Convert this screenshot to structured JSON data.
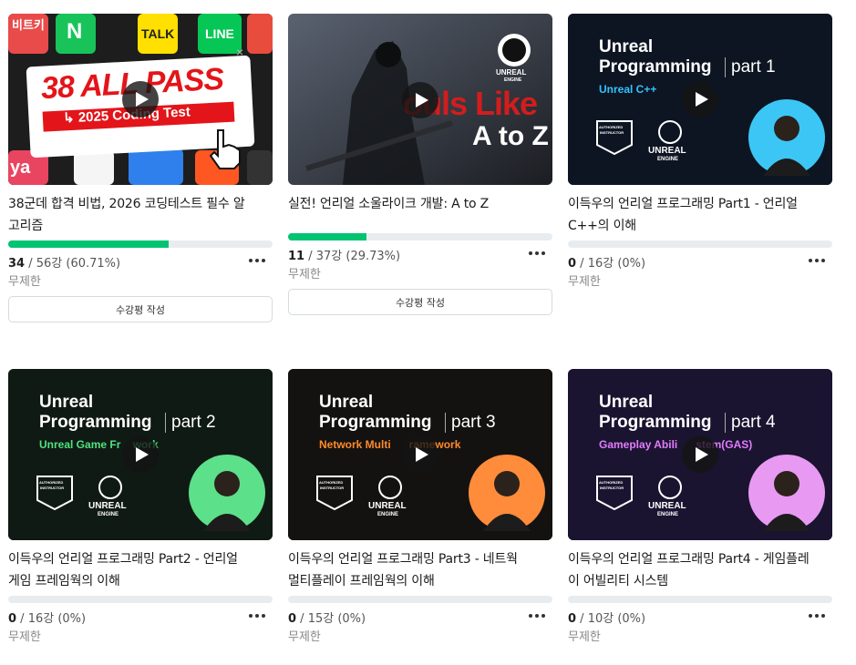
{
  "courses": [
    {
      "title_line1": "38군데 합격 비법, 2026 코딩테스트 필수 알",
      "title_line2": "고리즘",
      "progress_done": "34",
      "progress_rest": " / 56강 (60.71%)",
      "progress_fraction": 0.6071,
      "period": "무제한",
      "review_label": "수강평 작성",
      "thumb": {
        "badge_text": "38 ALL PASS",
        "sub_text": "↳ 2025 Coding Test",
        "app_labels": [
          "비트키",
          "N",
          "TALK",
          "LINE",
          "ya"
        ],
        "close_glyph": "×"
      }
    },
    {
      "title_line1": "실전! 언리얼 소울라이크 개발: A to Z",
      "title_line2": "",
      "progress_done": "11",
      "progress_rest": " / 37강 (29.73%)",
      "progress_fraction": 0.2973,
      "period": "무제한",
      "review_label": "수강평 작성",
      "thumb": {
        "big_text": "ouls Like",
        "sub_text": "A to Z",
        "logo_word": "UNREAL",
        "logo_sub": "ENGINE"
      }
    },
    {
      "title_line1": "이득우의 언리얼 프로그래밍 Part1 - 언리얼",
      "title_line2": "C++의 이해",
      "progress_done": "0",
      "progress_rest": " / 16강 (0%)",
      "progress_fraction": 0,
      "period": "무제한",
      "thumb": {
        "line1": "Unreal",
        "line2": "Programming",
        "part": "part 1",
        "subtitle": "Unreal C++",
        "accent": "#33c3ff",
        "bg": "#0d1522",
        "circle": "#3cc6f5"
      }
    },
    {
      "title_line1": "이득우의 언리얼 프로그래밍 Part2 - 언리얼",
      "title_line2": "게임 프레임웍의 이해",
      "progress_done": "0",
      "progress_rest": " / 16강 (0%)",
      "progress_fraction": 0,
      "period": "무제한",
      "thumb": {
        "line1": "Unreal",
        "line2": "Programming",
        "part": "part 2",
        "subtitle": "Unreal Game Fr    work",
        "accent": "#4ee37e",
        "bg": "#101a14",
        "circle": "#5de08a"
      }
    },
    {
      "title_line1": "이득우의 언리얼 프로그래밍 Part3 - 네트웍",
      "title_line2": "멀티플레이 프레임웍의 이해",
      "progress_done": "0",
      "progress_rest": " / 15강 (0%)",
      "progress_fraction": 0,
      "period": "무제한",
      "thumb": {
        "line1": "Unreal",
        "line2": "Programming",
        "part": "part 3",
        "subtitle": "Network Multi      ramework",
        "accent": "#ff8a2b",
        "bg": "#141210",
        "circle": "#ff8c3a"
      }
    },
    {
      "title_line1": "이득우의 언리얼 프로그래밍 Part4 - 게임플레",
      "title_line2": "이 어빌리티 시스템",
      "progress_done": "0",
      "progress_rest": " / 10강 (0%)",
      "progress_fraction": 0,
      "period": "무제한",
      "thumb": {
        "line1": "Unreal",
        "line2": "Programming",
        "part": "part 4",
        "subtitle": "Gameplay Abili      stem(GAS)",
        "accent": "#e47bff",
        "bg": "#1a1430",
        "circle": "#e89af2"
      }
    }
  ],
  "unreal_badge": {
    "authorized": "AUTHORIZED",
    "instructor": "INSTRUCTOR",
    "engine_word": "UNREAL",
    "engine_sub": "ENGINE"
  },
  "colors": {
    "progress_fill": "#00c471",
    "progress_track": "#e9ecef"
  }
}
